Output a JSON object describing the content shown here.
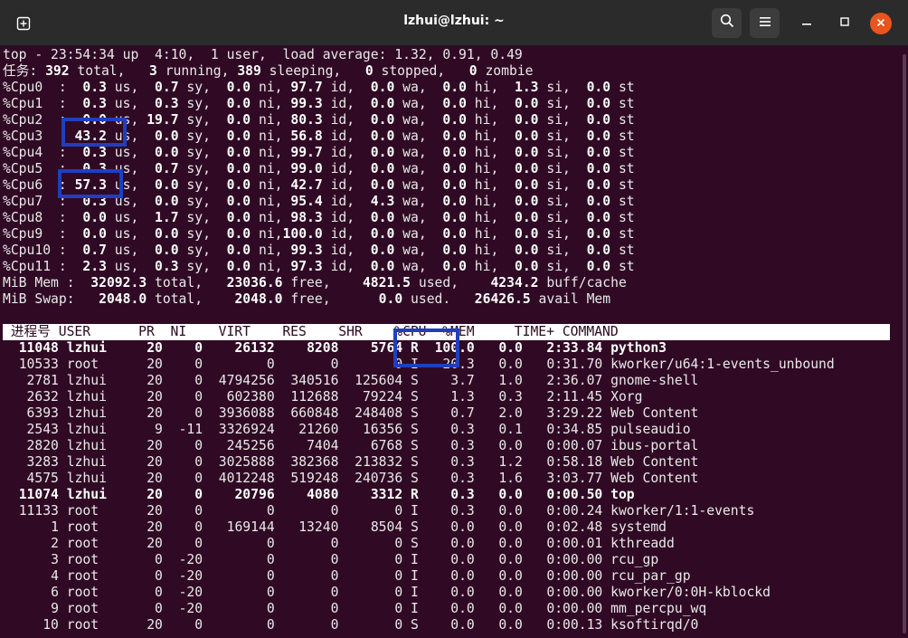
{
  "window": {
    "title": "lzhui@lzhui: ~"
  },
  "icons": {
    "new_tab": "new-tab-icon",
    "search": "search-icon",
    "menu": "hamburger-menu-icon",
    "minimize": "minimize-icon",
    "maximize": "maximize-icon",
    "close": "close-icon"
  },
  "colors": {
    "terminal_bg": "#300a24",
    "titlebar_bg": "#2b2b2b",
    "close_button": "#e9541f",
    "highlight_box": "#1f3fbf"
  },
  "summary": {
    "uptime": "top - 23:54:34 up  4:10,  1 user,  load average: 1.32, 0.91, 0.49",
    "tasks": {
      "label": "任务:",
      "total": "392",
      "total_label": " total,",
      "running": "3",
      "running_label": " running,",
      "sleeping": "389",
      "sleeping_label": " sleeping,",
      "stopped": "0",
      "stopped_label": " stopped,",
      "zombie": "0",
      "zombie_label": " zombie"
    },
    "cpus": [
      {
        "label": "%Cpu0  :",
        "us": "  0.3",
        "sy": "  0.7",
        "ni": "  0.0",
        "id": " 97.7",
        "wa": "  0.0",
        "hi": "  0.0",
        "si": "  1.3",
        "st": "  0.0"
      },
      {
        "label": "%Cpu1  :",
        "us": "  0.3",
        "sy": "  0.3",
        "ni": "  0.0",
        "id": " 99.3",
        "wa": "  0.0",
        "hi": "  0.0",
        "si": "  0.0",
        "st": "  0.0"
      },
      {
        "label": "%Cpu2  :",
        "us": "  0.0",
        "sy": " 19.7",
        "ni": "  0.0",
        "id": " 80.3",
        "wa": "  0.0",
        "hi": "  0.0",
        "si": "  0.0",
        "st": "  0.0"
      },
      {
        "label": "%Cpu3  :",
        "us": " 43.2",
        "sy": "  0.0",
        "ni": "  0.0",
        "id": " 56.8",
        "wa": "  0.0",
        "hi": "  0.0",
        "si": "  0.0",
        "st": "  0.0"
      },
      {
        "label": "%Cpu4  :",
        "us": "  0.3",
        "sy": "  0.0",
        "ni": "  0.0",
        "id": " 99.7",
        "wa": "  0.0",
        "hi": "  0.0",
        "si": "  0.0",
        "st": "  0.0"
      },
      {
        "label": "%Cpu5  :",
        "us": "  0.3",
        "sy": "  0.7",
        "ni": "  0.0",
        "id": " 99.0",
        "wa": "  0.0",
        "hi": "  0.0",
        "si": "  0.0",
        "st": "  0.0"
      },
      {
        "label": "%Cpu6  :",
        "us": " 57.3",
        "sy": "  0.0",
        "ni": "  0.0",
        "id": " 42.7",
        "wa": "  0.0",
        "hi": "  0.0",
        "si": "  0.0",
        "st": "  0.0"
      },
      {
        "label": "%Cpu7  :",
        "us": "  0.3",
        "sy": "  0.0",
        "ni": "  0.0",
        "id": " 95.4",
        "wa": "  4.3",
        "hi": "  0.0",
        "si": "  0.0",
        "st": "  0.0"
      },
      {
        "label": "%Cpu8  :",
        "us": "  0.0",
        "sy": "  1.7",
        "ni": "  0.0",
        "id": " 98.3",
        "wa": "  0.0",
        "hi": "  0.0",
        "si": "  0.0",
        "st": "  0.0"
      },
      {
        "label": "%Cpu9  :",
        "us": "  0.0",
        "sy": "  0.0",
        "ni": "  0.0",
        "id": "100.0",
        "wa": "  0.0",
        "hi": "  0.0",
        "si": "  0.0",
        "st": "  0.0"
      },
      {
        "label": "%Cpu10 :",
        "us": "  0.7",
        "sy": "  0.0",
        "ni": "  0.0",
        "id": " 99.3",
        "wa": "  0.0",
        "hi": "  0.0",
        "si": "  0.0",
        "st": "  0.0"
      },
      {
        "label": "%Cpu11 :",
        "us": "  2.3",
        "sy": "  0.3",
        "ni": "  0.0",
        "id": " 97.3",
        "wa": "  0.0",
        "hi": "  0.0",
        "si": "  0.0",
        "st": "  0.0"
      }
    ],
    "mem": {
      "label": "MiB Mem : ",
      "total": "32092.3",
      "free": "23036.6",
      "used": "4821.5",
      "buff_cache": "4234.2"
    },
    "swap": {
      "label": "MiB Swap: ",
      "total": "2048.0",
      "free": "2048.0",
      "used": "0.0",
      "avail": "26426.5"
    }
  },
  "process_table": {
    "header": " 进程号 USER      PR  NI    VIRT    RES    SHR    %CPU  %MEM     TIME+ COMMAND",
    "rows": [
      {
        "pid": "11048",
        "user": "lzhui",
        "pr": "20",
        "ni": "0",
        "virt": "26132",
        "res": "8208",
        "shr": "5764",
        "s": "R",
        "cpu": "100.0",
        "mem": "0.0",
        "time": "2:33.84",
        "command": "python3",
        "bold": true
      },
      {
        "pid": "10533",
        "user": "root",
        "pr": "20",
        "ni": "0",
        "virt": "0",
        "res": "0",
        "shr": "0",
        "s": "I",
        "cpu": "20.3",
        "mem": "0.0",
        "time": "0:31.70",
        "command": "kworker/u64:1-events_unbound",
        "bold": false
      },
      {
        "pid": "2781",
        "user": "lzhui",
        "pr": "20",
        "ni": "0",
        "virt": "4794256",
        "res": "340516",
        "shr": "125604",
        "s": "S",
        "cpu": "3.7",
        "mem": "1.0",
        "time": "2:36.07",
        "command": "gnome-shell",
        "bold": false
      },
      {
        "pid": "2632",
        "user": "lzhui",
        "pr": "20",
        "ni": "0",
        "virt": "602380",
        "res": "112688",
        "shr": "79224",
        "s": "S",
        "cpu": "1.3",
        "mem": "0.3",
        "time": "2:11.45",
        "command": "Xorg",
        "bold": false
      },
      {
        "pid": "6393",
        "user": "lzhui",
        "pr": "20",
        "ni": "0",
        "virt": "3936088",
        "res": "660848",
        "shr": "248408",
        "s": "S",
        "cpu": "0.7",
        "mem": "2.0",
        "time": "3:29.22",
        "command": "Web Content",
        "bold": false
      },
      {
        "pid": "2543",
        "user": "lzhui",
        "pr": "9",
        "ni": "-11",
        "virt": "3326924",
        "res": "21260",
        "shr": "16356",
        "s": "S",
        "cpu": "0.3",
        "mem": "0.1",
        "time": "0:34.85",
        "command": "pulseaudio",
        "bold": false
      },
      {
        "pid": "2820",
        "user": "lzhui",
        "pr": "20",
        "ni": "0",
        "virt": "245256",
        "res": "7404",
        "shr": "6768",
        "s": "S",
        "cpu": "0.3",
        "mem": "0.0",
        "time": "0:00.07",
        "command": "ibus-portal",
        "bold": false
      },
      {
        "pid": "3283",
        "user": "lzhui",
        "pr": "20",
        "ni": "0",
        "virt": "3025888",
        "res": "382368",
        "shr": "213832",
        "s": "S",
        "cpu": "0.3",
        "mem": "1.2",
        "time": "0:58.18",
        "command": "Web Content",
        "bold": false
      },
      {
        "pid": "4575",
        "user": "lzhui",
        "pr": "20",
        "ni": "0",
        "virt": "4012248",
        "res": "519248",
        "shr": "240736",
        "s": "S",
        "cpu": "0.3",
        "mem": "1.6",
        "time": "3:03.77",
        "command": "Web Content",
        "bold": false
      },
      {
        "pid": "11074",
        "user": "lzhui",
        "pr": "20",
        "ni": "0",
        "virt": "20796",
        "res": "4080",
        "shr": "3312",
        "s": "R",
        "cpu": "0.3",
        "mem": "0.0",
        "time": "0:00.50",
        "command": "top",
        "bold": true
      },
      {
        "pid": "11133",
        "user": "root",
        "pr": "20",
        "ni": "0",
        "virt": "0",
        "res": "0",
        "shr": "0",
        "s": "I",
        "cpu": "0.3",
        "mem": "0.0",
        "time": "0:00.24",
        "command": "kworker/1:1-events",
        "bold": false
      },
      {
        "pid": "1",
        "user": "root",
        "pr": "20",
        "ni": "0",
        "virt": "169144",
        "res": "13240",
        "shr": "8504",
        "s": "S",
        "cpu": "0.0",
        "mem": "0.0",
        "time": "0:02.48",
        "command": "systemd",
        "bold": false
      },
      {
        "pid": "2",
        "user": "root",
        "pr": "20",
        "ni": "0",
        "virt": "0",
        "res": "0",
        "shr": "0",
        "s": "S",
        "cpu": "0.0",
        "mem": "0.0",
        "time": "0:00.01",
        "command": "kthreadd",
        "bold": false
      },
      {
        "pid": "3",
        "user": "root",
        "pr": "0",
        "ni": "-20",
        "virt": "0",
        "res": "0",
        "shr": "0",
        "s": "I",
        "cpu": "0.0",
        "mem": "0.0",
        "time": "0:00.00",
        "command": "rcu_gp",
        "bold": false
      },
      {
        "pid": "4",
        "user": "root",
        "pr": "0",
        "ni": "-20",
        "virt": "0",
        "res": "0",
        "shr": "0",
        "s": "I",
        "cpu": "0.0",
        "mem": "0.0",
        "time": "0:00.00",
        "command": "rcu_par_gp",
        "bold": false
      },
      {
        "pid": "6",
        "user": "root",
        "pr": "0",
        "ni": "-20",
        "virt": "0",
        "res": "0",
        "shr": "0",
        "s": "I",
        "cpu": "0.0",
        "mem": "0.0",
        "time": "0:00.00",
        "command": "kworker/0:0H-kblockd",
        "bold": false
      },
      {
        "pid": "9",
        "user": "root",
        "pr": "0",
        "ni": "-20",
        "virt": "0",
        "res": "0",
        "shr": "0",
        "s": "I",
        "cpu": "0.0",
        "mem": "0.0",
        "time": "0:00.00",
        "command": "mm_percpu_wq",
        "bold": false
      },
      {
        "pid": "10",
        "user": "root",
        "pr": "20",
        "ni": "0",
        "virt": "0",
        "res": "0",
        "shr": "0",
        "s": "S",
        "cpu": "0.0",
        "mem": "0.0",
        "time": "0:00.13",
        "command": "ksoftirqd/0",
        "bold": false
      }
    ]
  }
}
